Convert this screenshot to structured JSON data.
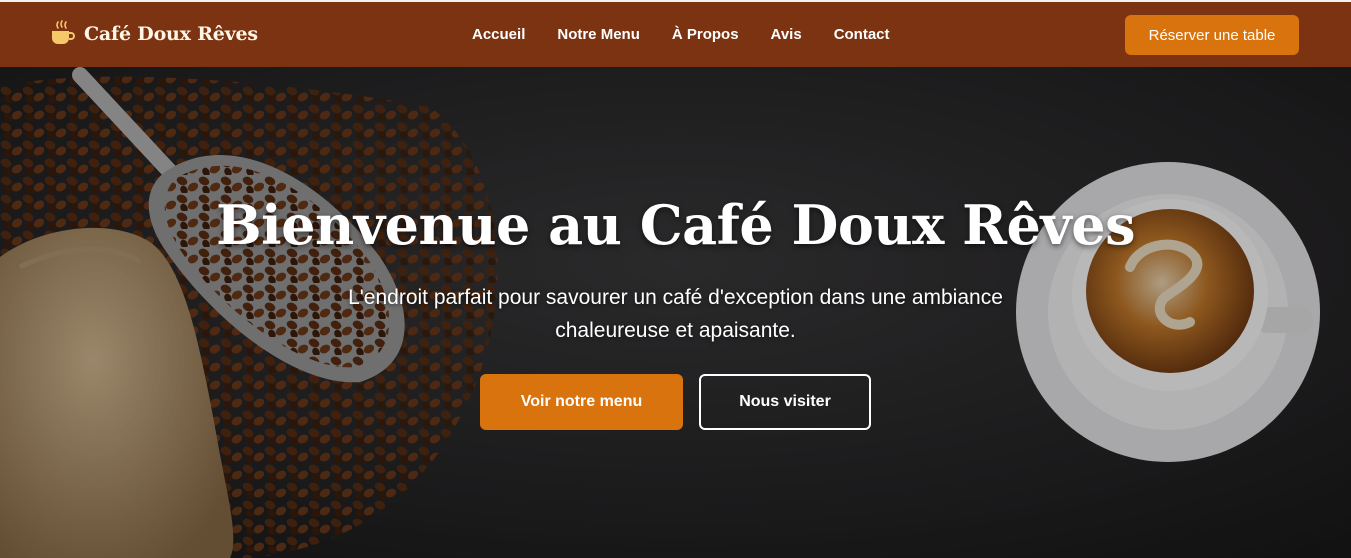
{
  "brand": {
    "name": "Café Doux Rêves",
    "icon": "coffee-cup-icon"
  },
  "nav": {
    "links": [
      "Accueil",
      "Notre Menu",
      "À Propos",
      "Avis",
      "Contact"
    ],
    "reserve_label": "Réserver une table"
  },
  "hero": {
    "title": "Bienvenue au Café Doux Rêves",
    "subtitle": "L'endroit parfait pour savourer un café d'exception dans une ambiance chaleureuse et apaisante.",
    "primary_button": "Voir notre menu",
    "secondary_button": "Nous visiter"
  },
  "colors": {
    "navbar": "#7b3311",
    "accent": "#d9730d",
    "brand_icon": "#f5c86a"
  }
}
